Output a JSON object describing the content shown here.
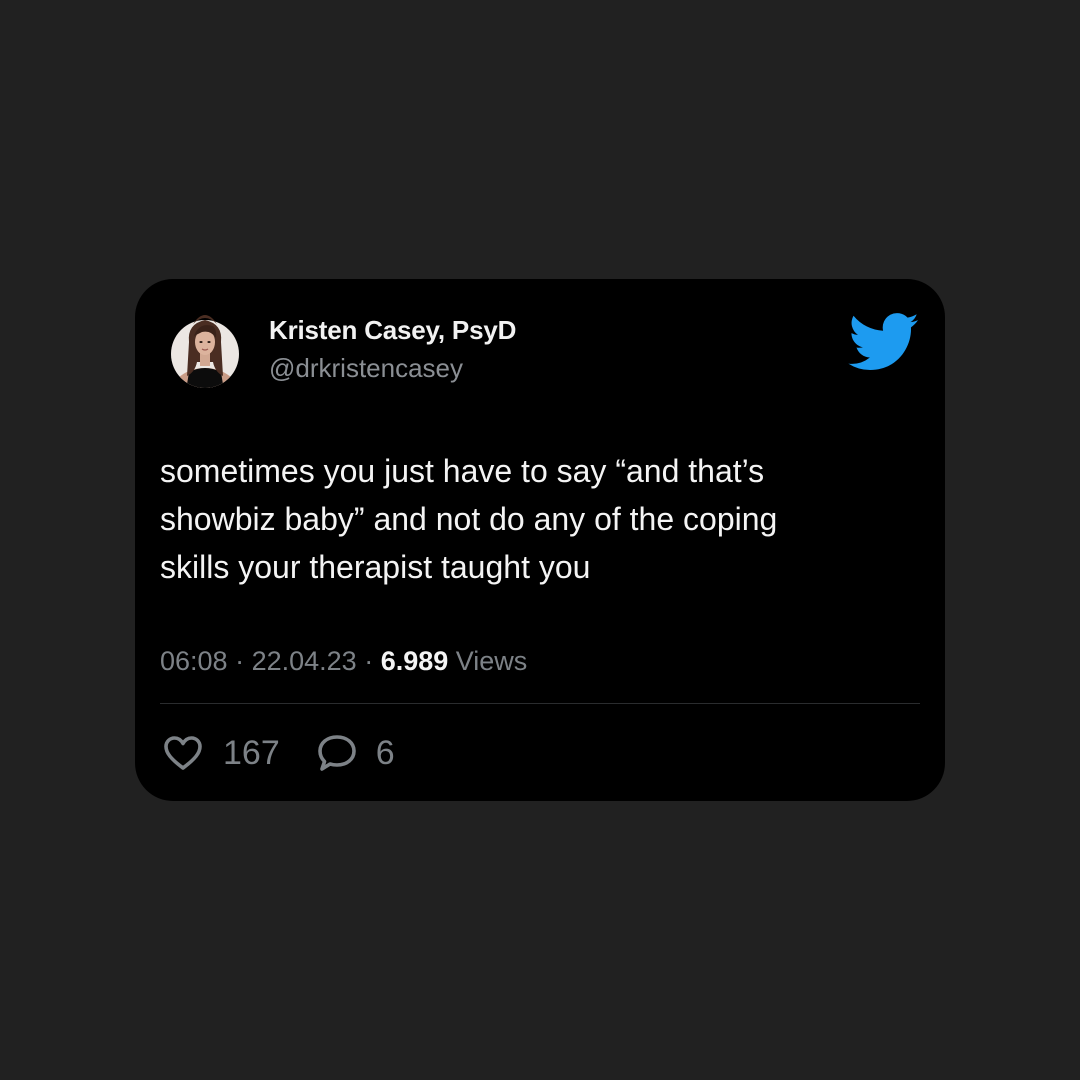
{
  "tweet": {
    "author_name": "Kristen Casey, PsyD",
    "author_handle": "@drkristencasey",
    "text_lines": [
      "sometimes you just have to say “and that’s",
      "showbiz baby” and not do any of the coping",
      "skills your therapist taught you"
    ],
    "time": "06:08",
    "date": "22.04.23",
    "separator": " · ",
    "views_count": "6.989",
    "views_label": " Views",
    "likes": "167",
    "replies": "6"
  },
  "icons": {
    "brand": "twitter-bird-icon",
    "like": "heart-icon",
    "reply": "speech-bubble-icon"
  },
  "colors": {
    "page_background": "#212121",
    "card_background": "#000000",
    "brand_blue": "#1d9bf0",
    "secondary_text": "#7d8287",
    "primary_text": "#f4f4f4"
  }
}
